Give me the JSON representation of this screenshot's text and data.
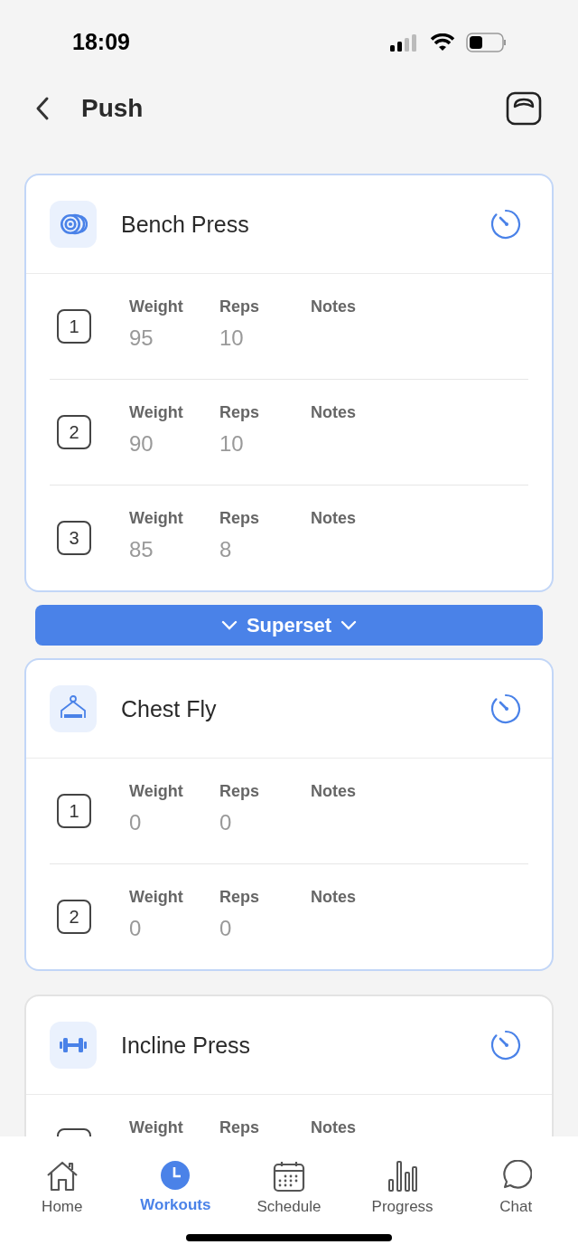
{
  "status_bar": {
    "time": "18:09"
  },
  "header": {
    "title": "Push"
  },
  "exercises": [
    {
      "name": "Bench Press",
      "highlighted": true,
      "sets": [
        {
          "number": "1",
          "weight_label": "Weight",
          "weight": "95",
          "reps_label": "Reps",
          "reps": "10",
          "notes_label": "Notes"
        },
        {
          "number": "2",
          "weight_label": "Weight",
          "weight": "90",
          "reps_label": "Reps",
          "reps": "10",
          "notes_label": "Notes"
        },
        {
          "number": "3",
          "weight_label": "Weight",
          "weight": "85",
          "reps_label": "Reps",
          "reps": "8",
          "notes_label": "Notes"
        }
      ]
    },
    {
      "name": "Chest Fly",
      "highlighted": true,
      "superset_above": "Superset",
      "sets": [
        {
          "number": "1",
          "weight_label": "Weight",
          "weight": "0",
          "reps_label": "Reps",
          "reps": "0",
          "notes_label": "Notes"
        },
        {
          "number": "2",
          "weight_label": "Weight",
          "weight": "0",
          "reps_label": "Reps",
          "reps": "0",
          "notes_label": "Notes"
        }
      ]
    },
    {
      "name": "Incline Press",
      "highlighted": false,
      "sets": [
        {
          "weight_label": "Weight",
          "reps_label": "Reps",
          "notes_label": "Notes"
        }
      ]
    }
  ],
  "tabs": [
    {
      "label": "Home",
      "selected": false
    },
    {
      "label": "Workouts",
      "selected": true
    },
    {
      "label": "Schedule",
      "selected": false
    },
    {
      "label": "Progress",
      "selected": false
    },
    {
      "label": "Chat",
      "selected": false
    }
  ]
}
